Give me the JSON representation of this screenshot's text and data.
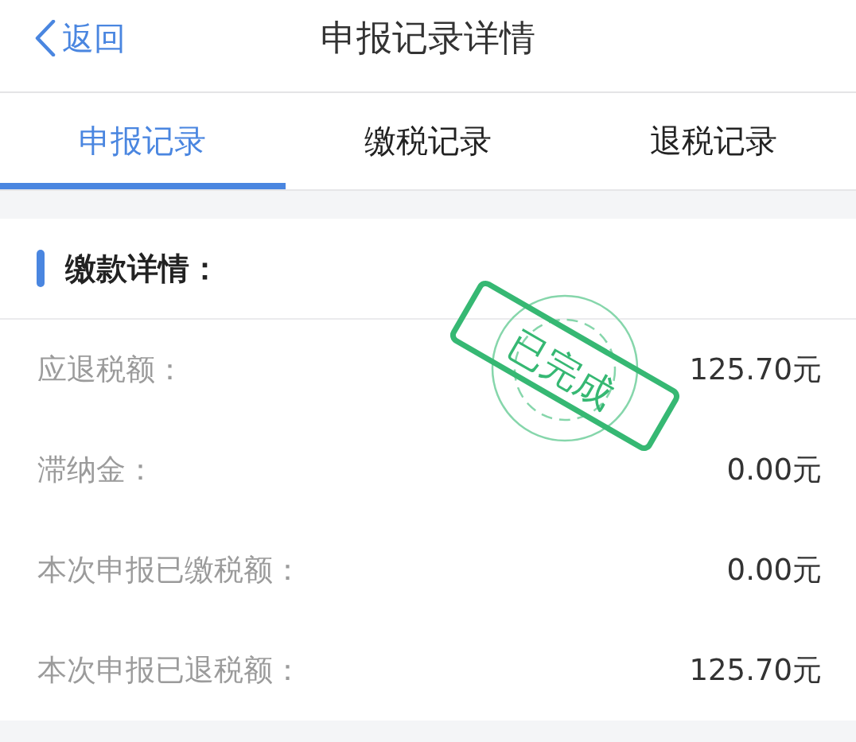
{
  "header": {
    "back_label": "返回",
    "title": "申报记录详情"
  },
  "tabs": [
    {
      "label": "申报记录",
      "selected": true
    },
    {
      "label": "缴税记录",
      "selected": false
    },
    {
      "label": "退税记录",
      "selected": false
    }
  ],
  "section": {
    "title": "缴款详情：",
    "rows": [
      {
        "label": "应退税额：",
        "value": "125.70元"
      },
      {
        "label": "滞纳金：",
        "value": "0.00元"
      },
      {
        "label": "本次申报已缴税额：",
        "value": "0.00元"
      },
      {
        "label": "本次申报已退税额：",
        "value": "125.70元"
      }
    ]
  },
  "stamp": {
    "text": "已完成"
  }
}
